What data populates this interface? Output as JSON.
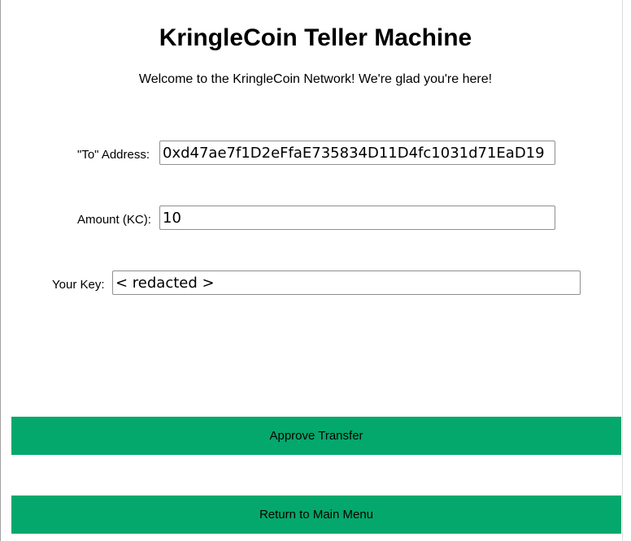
{
  "header": {
    "title": "KringleCoin Teller Machine",
    "welcome": "Welcome to the KringleCoin Network! We're glad you're here!"
  },
  "form": {
    "to_address": {
      "label": "\"To\" Address:",
      "value": "0xd47ae7f1D2eFfaE735834D11D4fc1031d71EaD19"
    },
    "amount": {
      "label": "Amount (KC):",
      "value": "10"
    },
    "key": {
      "label": "Your Key:",
      "value": "< redacted >"
    }
  },
  "actions": {
    "approve_label": "Approve Transfer",
    "return_label": "Return to Main Menu"
  },
  "colors": {
    "button_background": "#05a86c"
  }
}
